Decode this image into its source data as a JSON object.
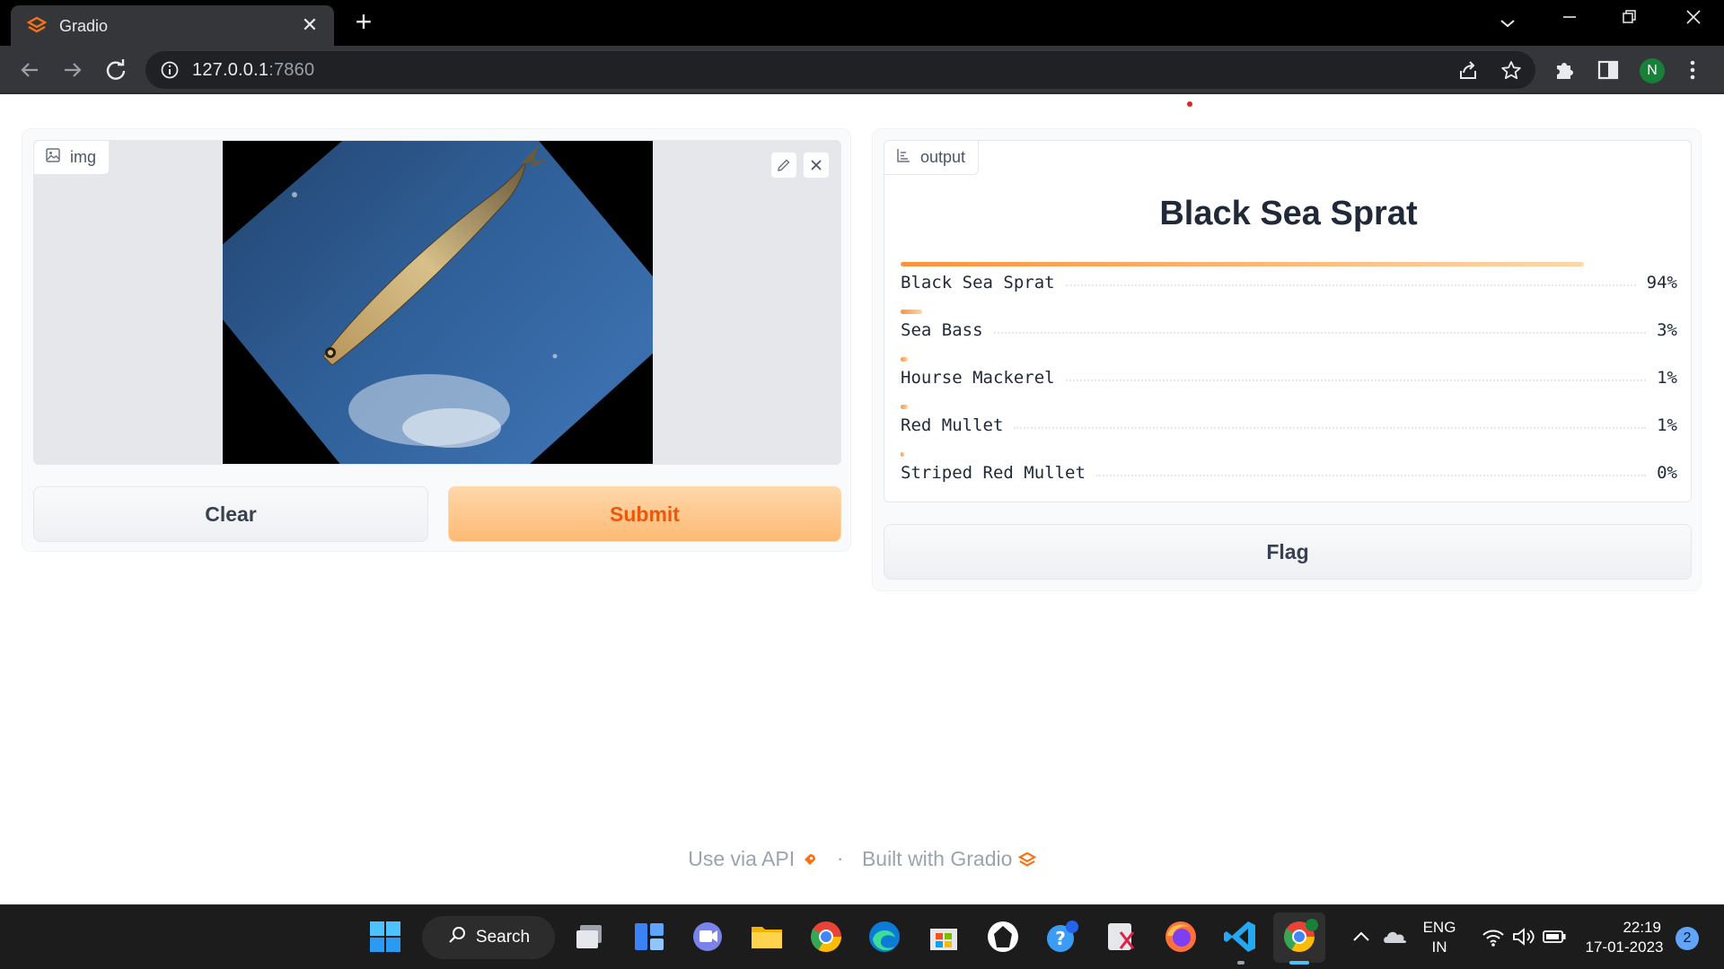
{
  "browser": {
    "tab_title": "Gradio",
    "url_host": "127.0.0.1",
    "url_port": ":7860"
  },
  "input_panel": {
    "image_label": "img",
    "clear_label": "Clear",
    "submit_label": "Submit"
  },
  "output_panel": {
    "label": "output",
    "top_prediction": "Black Sea Sprat",
    "confidences": [
      {
        "label": "Black Sea Sprat",
        "value_text": "94%",
        "value": 0.94
      },
      {
        "label": "Sea Bass",
        "value_text": "3%",
        "value": 0.03
      },
      {
        "label": "Hourse Mackerel",
        "value_text": "1%",
        "value": 0.01
      },
      {
        "label": "Red Mullet",
        "value_text": "1%",
        "value": 0.01
      },
      {
        "label": "Striped Red Mullet",
        "value_text": "0%",
        "value": 0.004
      }
    ],
    "flag_label": "Flag"
  },
  "footer": {
    "api_text": "Use via API",
    "separator": "·",
    "built_text": "Built with Gradio"
  },
  "taskbar": {
    "search_label": "Search",
    "lang_line1": "ENG",
    "lang_line2": "IN",
    "time": "22:19",
    "date": "17-01-2023",
    "notification_count": "2"
  },
  "colors": {
    "accent": "#f97316",
    "submit_bg": "#fdba74",
    "bar_start": "#fb923c",
    "bar_end": "#fed7aa"
  },
  "icons": [
    "gradio-logo-icon",
    "close-icon",
    "plus-icon",
    "tab-search-icon",
    "minimize-icon",
    "restore-icon",
    "back-icon",
    "forward-icon",
    "reload-icon",
    "info-icon",
    "share-icon",
    "star-icon",
    "extensions-icon",
    "sidepanel-icon",
    "menu-icon",
    "image-icon",
    "edit-icon",
    "chart-icon",
    "rocket-icon"
  ]
}
